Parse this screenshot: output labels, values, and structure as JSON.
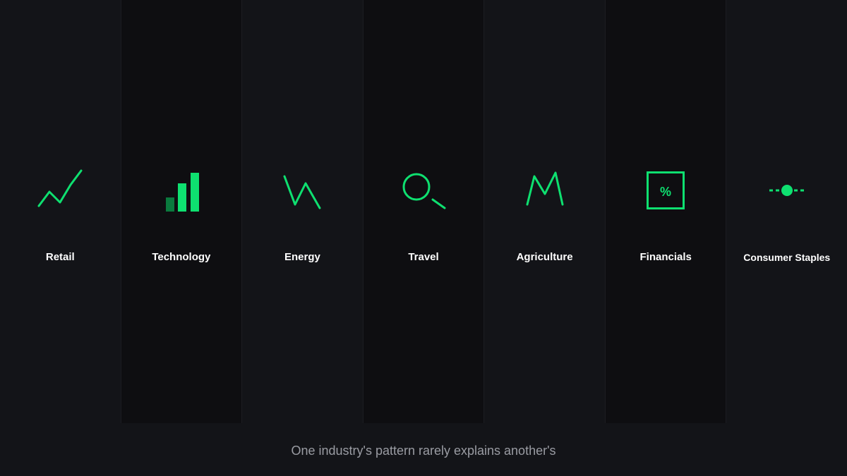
{
  "colors": {
    "accent": "#0ee070",
    "accent_dim": "#0a7a3e",
    "background": "#131418",
    "column_dark": "#0e0e11",
    "label_text": "#ffffff",
    "caption_text": "#9a9ca3"
  },
  "sectors": [
    {
      "label": "Retail",
      "icon": "trend-line-icon"
    },
    {
      "label": "Technology",
      "icon": "bar-chart-icon"
    },
    {
      "label": "Energy",
      "icon": "zigzag-line-icon"
    },
    {
      "label": "Travel",
      "icon": "magnifier-icon"
    },
    {
      "label": "Agriculture",
      "icon": "peaks-line-icon"
    },
    {
      "label": "Financials",
      "icon": "percent-box-icon",
      "icon_text": "%"
    },
    {
      "label": "Consumer Staples",
      "icon": "dot-dash-icon"
    }
  ],
  "caption": "One industry's pattern rarely explains another's"
}
